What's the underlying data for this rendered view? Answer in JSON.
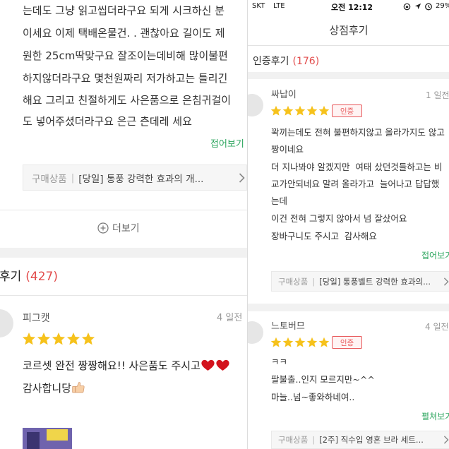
{
  "left_panel": {
    "expanded_review": {
      "lines": [
        "는데도 그냥 읽고씹더라구요 되게 시크하신 분",
        "이세요 이제 택배온물건. . 괜찮아요 길이도 제",
        "원한 25cm딱맞구요 잘조이는데비해 많이불편",
        "하지않더라구요 몇천원짜리 저가하고는 틀리긴",
        "해요 그리고 친절하게도 사은품으로 은침귀걸이",
        "도 넣어주셨더라구요 은근 츤데레 세요"
      ],
      "toggle": "접어보기",
      "product": {
        "label": "구매상품",
        "separator": "|",
        "name": "[당일] 통풍 강력한 효과의 개..."
      }
    },
    "more_label": "더보기",
    "reviews_section": {
      "title": "후기",
      "count": "(427)"
    },
    "review": {
      "author": "피그캣",
      "date": "4 일전",
      "rating": 5,
      "lines": [
        "코르셋 완전 짱짱해요!! 사은품도 주시고",
        "감사합니당"
      ],
      "icons": {
        "line_1_end": [
          "heart-icon",
          "heart-icon"
        ],
        "line_2_end": [
          "thumbs-up-icon"
        ]
      }
    }
  },
  "right_panel": {
    "status_bar": {
      "carrier": "SKT",
      "network": "LTE",
      "time": "오전 12:12",
      "battery": "29%",
      "icons": [
        "orientation-lock-icon",
        "location-icon",
        "alarm-icon"
      ]
    },
    "header_title": "상점후기",
    "section": {
      "title": "인증후기",
      "count": "(176)"
    },
    "reviews": [
      {
        "author": "싸납이",
        "date": "1 일전",
        "rating": 5,
        "badge": "인증",
        "lines": [
          "꽉끼는데도 전혀 불편하지않고 올라가지도 않고",
          "짱이네요",
          "더 지나봐야 알겠지만  여태 샀던것들하고는 비",
          "교가안되네요 말려 올라가고  늘어나고 답답했",
          "는데",
          "이건 전혀 그렇지 않아서 넘 잘샀어요",
          "장바구니도 주시고  감사해요"
        ],
        "toggle": "접어보기",
        "product": {
          "label": "구매상품",
          "separator": "|",
          "name": "[당일] 통풍벨트 강력한 효과의..."
        }
      },
      {
        "author": "느토버므",
        "date": "4 일전",
        "rating": 5,
        "badge": "인증",
        "lines": [
          "ㅋㅋ",
          "팔불출..인지 모르지만~^^",
          "마늘..넘~좋와하네여.."
        ],
        "toggle": "펼쳐보기",
        "product": {
          "label": "구매상품",
          "separator": "|",
          "name": "[2주] 직수입 영혼 브라 세트..."
        }
      }
    ]
  },
  "colors": {
    "accent_green": "#2ba55d",
    "count_red": "#e24c4c",
    "star": "#f6c21c",
    "badge_red": "#e8595b",
    "heart": "#d3131d"
  }
}
